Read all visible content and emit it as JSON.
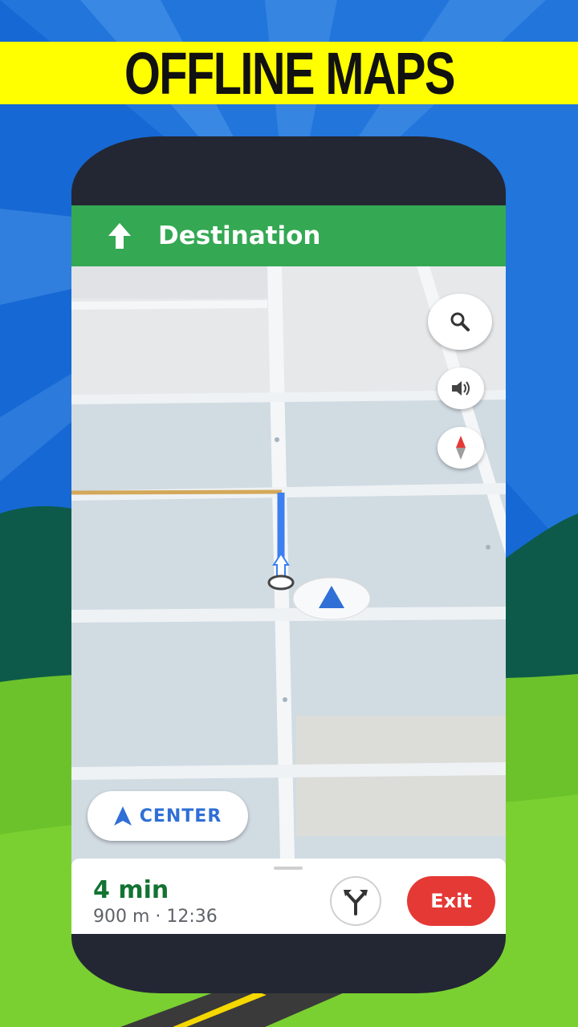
{
  "banner": {
    "title": "OFFLINE MAPS"
  },
  "navigation": {
    "instruction": "Destination",
    "direction_icon": "arrow-up-icon"
  },
  "map_controls": {
    "search_icon": "search-icon",
    "sound_icon": "volume-icon",
    "compass_icon": "compass-icon"
  },
  "center_button": {
    "label": "CENTER",
    "icon": "navigation-arrow-icon"
  },
  "trip": {
    "duration": "4 min",
    "details": "900 m · 12:36",
    "alt_routes_icon": "alternate-routes-icon",
    "exit_label": "Exit"
  },
  "colors": {
    "banner": "#ffff00",
    "header": "#34a853",
    "route": "#3c7ff0",
    "exit": "#e53935",
    "eta": "#137333",
    "accent": "#2f6fd6"
  }
}
